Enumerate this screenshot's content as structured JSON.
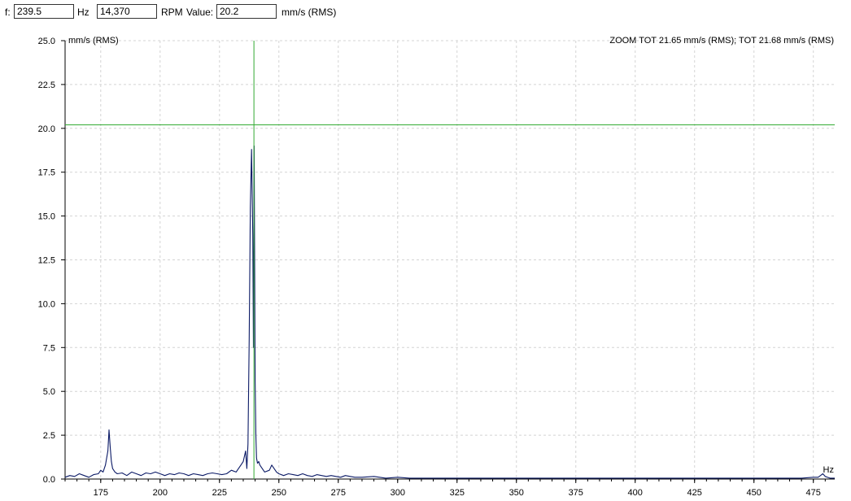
{
  "cursor": {
    "freq_label": "f:",
    "freq_value": "239.5",
    "freq_unit": "Hz",
    "rpm_value": "14,370",
    "rpm_unit": "RPM",
    "value_label": "Value:",
    "amp_value": "20.2",
    "amp_unit": "mm/s (RMS)"
  },
  "colors": {
    "trace": "#0b1a66",
    "cursor": "#33aa33",
    "grid": "#d4d4d4",
    "axis": "#000000"
  },
  "chart_data": {
    "type": "line",
    "ylabel": "mm/s (RMS)",
    "xlabel": "Hz",
    "annotation": "ZOOM TOT 21.65 mm/s (RMS); TOT 21.68 mm/s (RMS)",
    "xlim": [
      160,
      484
    ],
    "ylim": [
      0,
      25
    ],
    "xticks": [
      175,
      200,
      225,
      250,
      275,
      300,
      325,
      350,
      375,
      400,
      425,
      450,
      475
    ],
    "yticks": [
      "0.0",
      "2.5",
      "5.0",
      "7.5",
      "10.0",
      "12.5",
      "15.0",
      "17.5",
      "20.0",
      "22.5",
      "25.0"
    ],
    "grid": true,
    "cursor": {
      "x": 239.5,
      "y": 20.2
    },
    "series": [
      {
        "x": [
          160,
          162,
          164,
          166,
          168,
          170,
          172,
          174,
          175,
          176,
          177,
          178,
          178.5,
          179,
          179.5,
          180,
          181,
          182,
          184,
          186,
          188,
          190,
          192,
          194,
          196,
          198,
          200,
          202,
          204,
          206,
          208,
          210,
          212,
          214,
          216,
          218,
          220,
          222,
          224,
          226,
          228,
          230,
          232,
          234,
          235,
          236,
          236.5,
          237,
          237.5,
          238,
          238.5,
          239,
          239.3,
          239.6,
          240,
          240.3,
          240.6,
          241,
          241.5,
          242,
          243,
          244,
          246,
          247,
          248,
          249,
          250,
          252,
          254,
          256,
          258,
          260,
          262,
          264,
          266,
          268,
          270,
          272,
          274,
          276,
          278,
          280,
          282,
          285,
          290,
          295,
          300,
          305,
          310,
          315,
          320,
          325,
          330,
          335,
          340,
          345,
          350,
          355,
          360,
          365,
          370,
          375,
          380,
          390,
          400,
          410,
          420,
          430,
          440,
          450,
          460,
          470,
          475,
          477,
          478,
          479,
          480,
          482,
          484
        ],
        "y": [
          0.1,
          0.2,
          0.15,
          0.3,
          0.2,
          0.1,
          0.25,
          0.3,
          0.5,
          0.4,
          0.8,
          1.6,
          2.8,
          1.8,
          1.0,
          0.6,
          0.4,
          0.3,
          0.35,
          0.2,
          0.4,
          0.3,
          0.2,
          0.35,
          0.3,
          0.4,
          0.3,
          0.2,
          0.3,
          0.25,
          0.35,
          0.3,
          0.2,
          0.3,
          0.25,
          0.2,
          0.3,
          0.35,
          0.3,
          0.25,
          0.3,
          0.5,
          0.4,
          0.8,
          1.0,
          1.6,
          0.6,
          2.0,
          8.0,
          15.5,
          18.8,
          13.9,
          7.5,
          19.0,
          5.6,
          2.5,
          1.2,
          0.9,
          1.0,
          0.8,
          0.6,
          0.4,
          0.5,
          0.8,
          0.6,
          0.4,
          0.3,
          0.2,
          0.3,
          0.25,
          0.2,
          0.3,
          0.2,
          0.15,
          0.25,
          0.2,
          0.15,
          0.2,
          0.15,
          0.1,
          0.2,
          0.15,
          0.1,
          0.1,
          0.15,
          0.05,
          0.1,
          0.05,
          0.05,
          0.05,
          0.05,
          0.05,
          0.05,
          0.05,
          0.05,
          0.05,
          0.05,
          0.05,
          0.05,
          0.05,
          0.05,
          0.05,
          0.05,
          0.05,
          0.05,
          0.05,
          0.05,
          0.05,
          0.05,
          0.05,
          0.05,
          0.05,
          0.1,
          0.1,
          0.2,
          0.3,
          0.15,
          0.05,
          0.05
        ]
      }
    ]
  }
}
